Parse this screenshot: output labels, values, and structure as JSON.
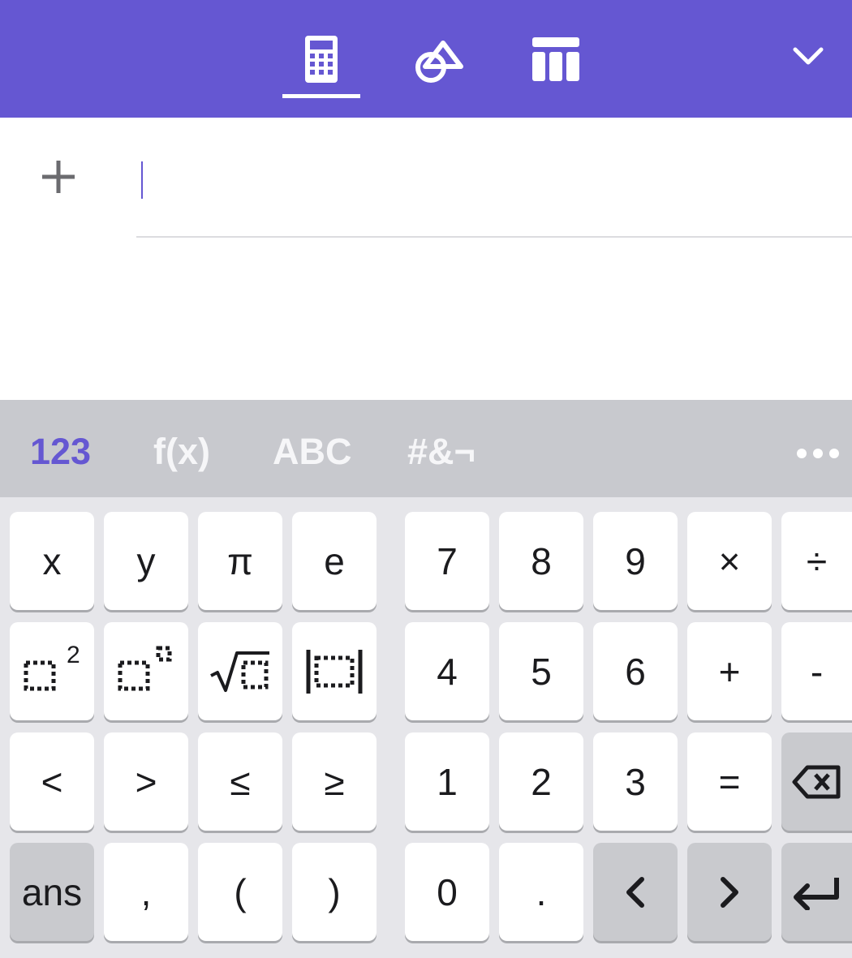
{
  "colors": {
    "accent": "#6557d2",
    "toolbar_bg": "#6557d2",
    "keyboard_bg": "#e6e6ea",
    "tabbar_bg": "#c8c9ce",
    "key_bg": "#ffffff",
    "key_dark_bg": "#c9cace"
  },
  "toolbar": {
    "tabs": [
      {
        "icon": "calculator-icon",
        "selected": true
      },
      {
        "icon": "geometry-shapes-icon",
        "selected": false
      },
      {
        "icon": "table-icon",
        "selected": false
      }
    ],
    "collapse_icon": "chevron-down-icon"
  },
  "algebra": {
    "add_icon": "plus-icon",
    "input_value": ""
  },
  "keyboard": {
    "tabs": [
      {
        "label": "123",
        "active": true
      },
      {
        "label": "f(x)",
        "active": false
      },
      {
        "label": "ABC",
        "active": false
      },
      {
        "label": "#&¬",
        "active": false
      }
    ],
    "more_icon": "more-dots-icon",
    "keys": {
      "x": "x",
      "y": "y",
      "pi": "π",
      "e": "e",
      "seven": "7",
      "eight": "8",
      "nine": "9",
      "times": "×",
      "divide": "÷",
      "square_exponent": "2",
      "four": "4",
      "five": "5",
      "six": "6",
      "plus": "+",
      "minus": "-",
      "less": "<",
      "greater": ">",
      "less_equal": "≤",
      "greater_equal": "≥",
      "one": "1",
      "two": "2",
      "three": "3",
      "equals": "=",
      "ans": "ans",
      "comma": ",",
      "open_paren": "(",
      "close_paren": ")",
      "zero": "0",
      "decimal": "."
    },
    "key_icons": {
      "square": "square-template-icon",
      "power": "power-template-icon",
      "sqrt": "square-root-template-icon",
      "abs": "absolute-value-template-icon",
      "backspace": "backspace-icon",
      "left": "arrow-left-icon",
      "right": "arrow-right-icon",
      "enter": "enter-icon"
    }
  }
}
